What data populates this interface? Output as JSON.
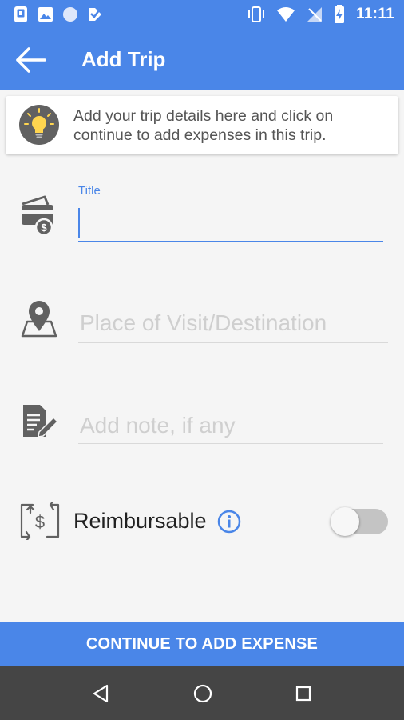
{
  "status_bar": {
    "time": "11:11",
    "left_icons": [
      "screenshot-notification-icon",
      "image-notification-icon",
      "circle-notification-icon",
      "app-notification-icon"
    ],
    "right_icons": [
      "vibrate-icon",
      "wifi-icon",
      "no-signal-icon",
      "battery-charging-icon"
    ]
  },
  "app_bar": {
    "title": "Add Trip",
    "back_icon": "arrow-left-icon"
  },
  "info_card": {
    "icon": "lightbulb-icon",
    "text": "Add your trip details here and click on continue to add expenses in this trip."
  },
  "form": {
    "title_field": {
      "label": "Title",
      "value": "",
      "icon": "wallet-card-icon"
    },
    "destination_field": {
      "placeholder": "Place of Visit/Destination",
      "value": "",
      "icon": "map-pin-icon"
    },
    "note_field": {
      "placeholder": "Add note, if any",
      "value": "",
      "icon": "note-edit-icon"
    },
    "reimbursable": {
      "label": "Reimbursable",
      "icon": "dollar-exchange-icon",
      "info_icon": "info-icon",
      "enabled": false
    }
  },
  "continue_button": {
    "label": "CONTINUE TO ADD EXPENSE"
  },
  "nav_bar": {
    "buttons": [
      "back-triangle-icon",
      "home-circle-icon",
      "recents-square-icon"
    ]
  },
  "colors": {
    "primary": "#4a86e8",
    "background": "#f5f5f5",
    "nav": "#454545",
    "icon_gray": "#616161"
  }
}
